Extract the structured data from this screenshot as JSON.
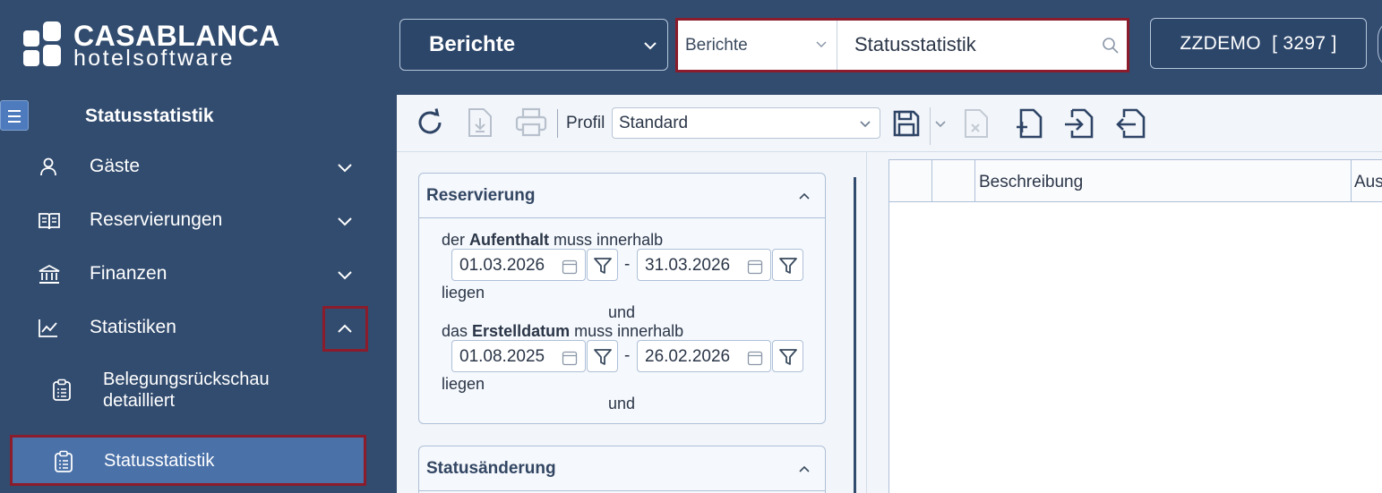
{
  "logo": {
    "title": "CASABLANCA",
    "subtitle": "hotelsoftware"
  },
  "top": {
    "module": "Berichte",
    "search": {
      "category": "Berichte",
      "value": "Statusstatistik"
    },
    "user": "ZZDEMO  [ 3297 ]"
  },
  "sidebar": {
    "title": "Statusstatistik",
    "items": [
      {
        "label": "Gäste",
        "icon": "person-icon"
      },
      {
        "label": "Reservierungen",
        "icon": "book-icon"
      },
      {
        "label": "Finanzen",
        "icon": "bank-icon"
      },
      {
        "label": "Statistiken",
        "icon": "chart-icon"
      }
    ],
    "sub": [
      {
        "label_line1": "Belegungsrückschau",
        "label_line2": "detailliert",
        "icon": "clipboard-icon"
      },
      {
        "label": "Statusstatistik",
        "icon": "clipboard-icon"
      }
    ]
  },
  "toolbar": {
    "profile_label": "Profil",
    "profile_value": "Standard"
  },
  "panel_reservierung": {
    "title": "Reservierung",
    "line1_prefix": "der",
    "line1_bold": "Aufenthalt",
    "line1_suffix": "muss innerhalb",
    "date_from": "01.03.2026",
    "date_to": "31.03.2026",
    "dash": "-",
    "liegen1": "liegen",
    "und1": "und",
    "line2_prefix": "das",
    "line2_bold": "Erstelldatum",
    "line2_suffix": "muss innerhalb",
    "date2_from": "01.08.2025",
    "date2_to": "26.02.2026",
    "liegen2": "liegen",
    "und2": "und"
  },
  "panel_status": {
    "title": "Statusänderung"
  },
  "grid": {
    "col_beschreibung": "Beschreibung",
    "col_next": "Aus"
  },
  "colors": {
    "sidebar_bg": "#324c6f",
    "active_item": "#4a71a8",
    "highlight_border": "#8a1c2b"
  }
}
